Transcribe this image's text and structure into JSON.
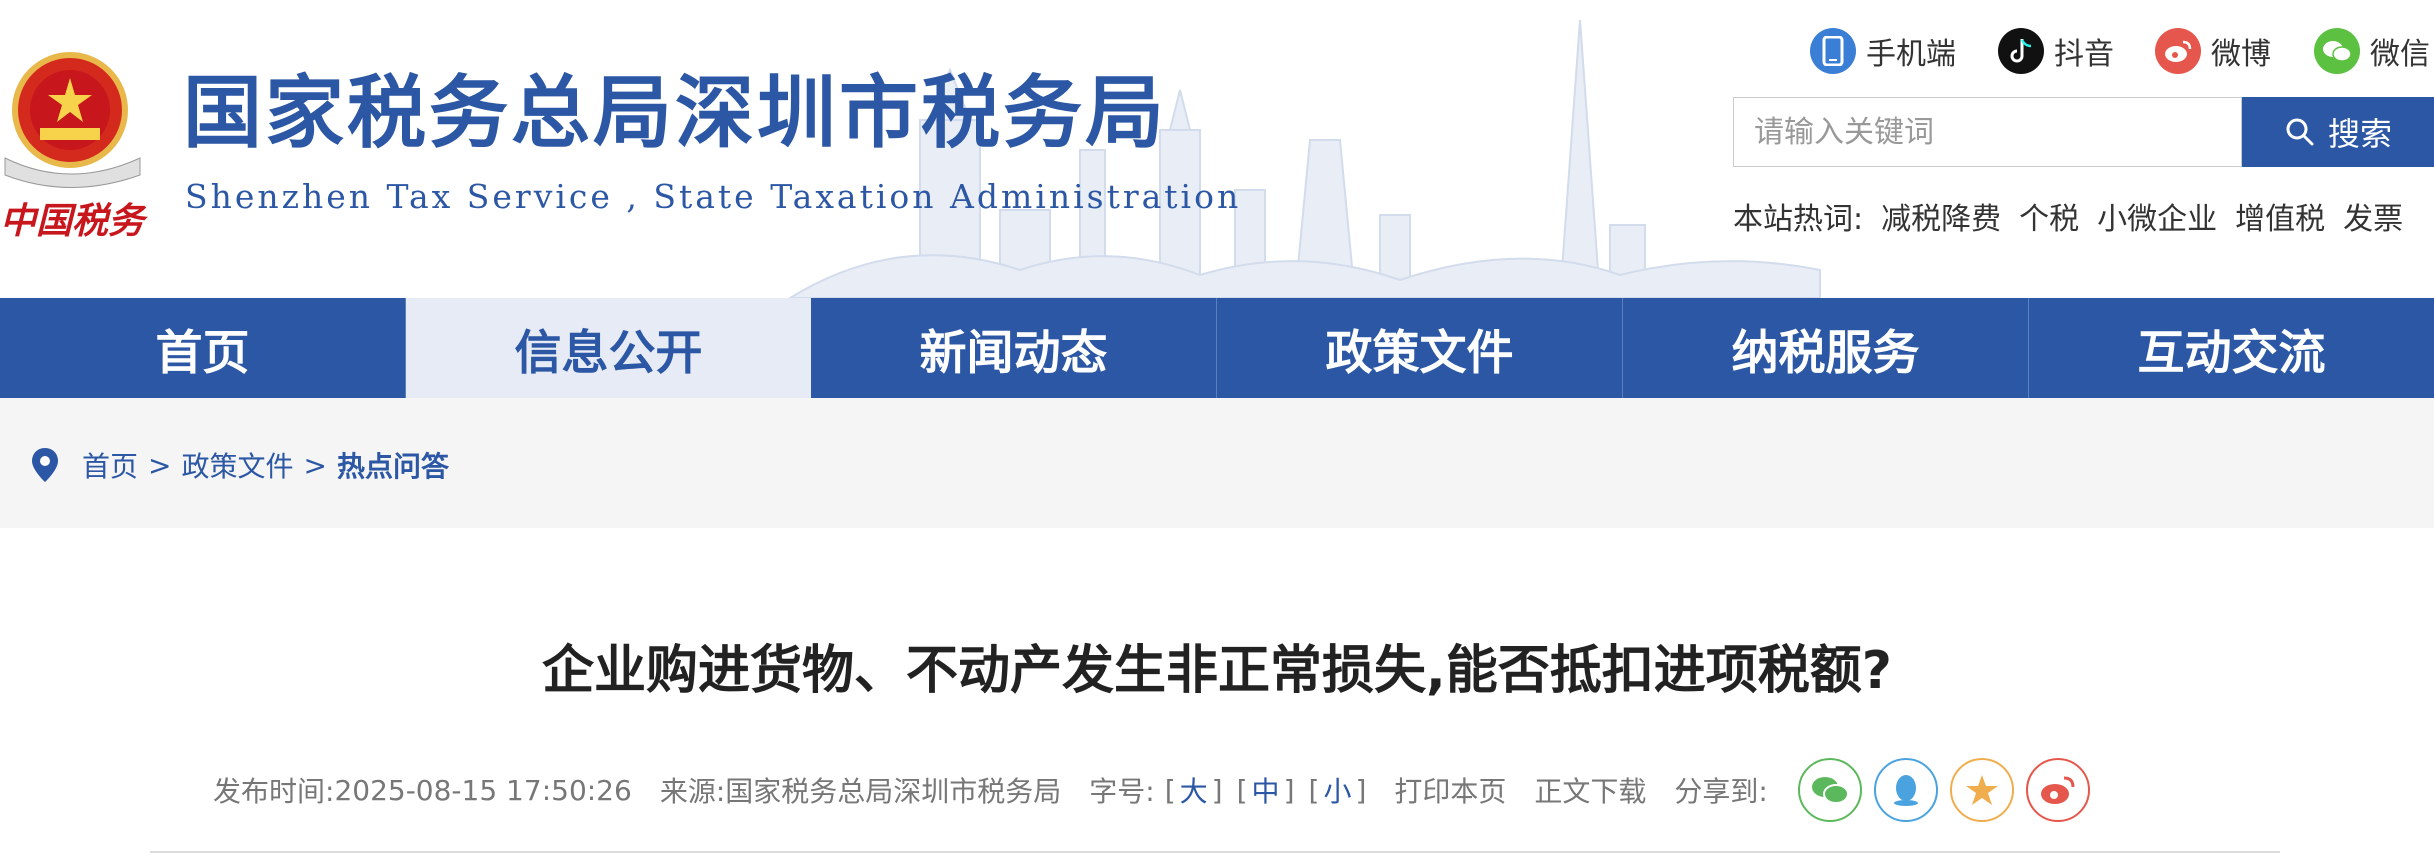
{
  "header": {
    "site_name_cn": "国家税务总局深圳市税务局",
    "site_name_en": "Shenzhen Tax Service , State Taxation Administration",
    "logo_text": "中国税务",
    "social": [
      {
        "label": "手机端",
        "icon": "mobile-icon",
        "color": "#3a7fd5"
      },
      {
        "label": "抖音",
        "icon": "douyin-icon",
        "color": "#111111"
      },
      {
        "label": "微博",
        "icon": "weibo-icon",
        "color": "#e5574c"
      },
      {
        "label": "微信",
        "icon": "wechat-icon",
        "color": "#5cc141"
      }
    ],
    "search": {
      "placeholder": "请输入关键词",
      "button_label": "搜索"
    },
    "hot_words": {
      "label": "本站热词:",
      "items": [
        "减税降费",
        "个税",
        "小微企业",
        "增值税",
        "发票"
      ]
    }
  },
  "nav": {
    "items": [
      {
        "label": "首页",
        "active": false
      },
      {
        "label": "信息公开",
        "active": true
      },
      {
        "label": "新闻动态",
        "active": false
      },
      {
        "label": "政策文件",
        "active": false
      },
      {
        "label": "纳税服务",
        "active": false
      },
      {
        "label": "互动交流",
        "active": false
      }
    ]
  },
  "breadcrumb": {
    "items": [
      "首页",
      "政策文件",
      "热点问答"
    ],
    "separator": ">"
  },
  "article": {
    "title": "企业购进货物、不动产发生非正常损失,能否抵扣进项税额?",
    "publish_label": "发布时间:",
    "publish_time": "2025-08-15 17:50:26",
    "source_label": "来源:",
    "source": "国家税务总局深圳市税务局",
    "font_label": "字号:",
    "font_sizes": [
      "大",
      "中",
      "小"
    ],
    "print_label": "打印本页",
    "download_label": "正文下载",
    "share_label": "分享到:",
    "share_targets": [
      {
        "icon": "wechat-share-icon",
        "color": "#5cb85c"
      },
      {
        "icon": "qq-share-icon",
        "color": "#4aa3df"
      },
      {
        "icon": "qzone-share-icon",
        "color": "#f0ad4e"
      },
      {
        "icon": "weibo-share-icon",
        "color": "#e5574c"
      }
    ]
  },
  "colors": {
    "brand": "#2c57a5",
    "nav_active_bg": "#e6ebf5"
  }
}
